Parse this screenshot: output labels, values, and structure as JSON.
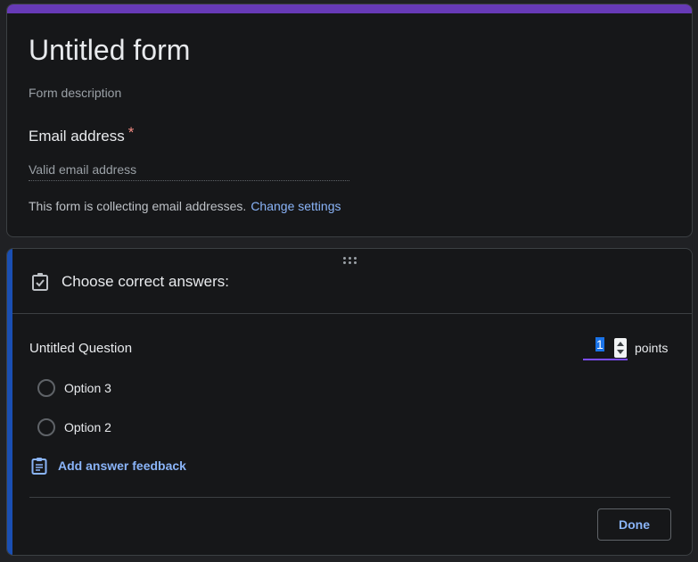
{
  "header": {
    "title": "Untitled form",
    "description": "Form description",
    "email_label": "Email address",
    "required_mark": "*",
    "email_placeholder": "Valid email address",
    "collecting_text": "This form is collecting email addresses.",
    "change_settings_label": "Change settings"
  },
  "question": {
    "section_title": "Choose correct answers:",
    "title": "Untitled Question",
    "points_value": "1",
    "points_label": "points",
    "options": [
      {
        "label": "Option 3"
      },
      {
        "label": "Option 2"
      }
    ],
    "feedback_label": "Add answer feedback",
    "done_label": "Done"
  },
  "icons": {
    "drag": "drag-handle-icon",
    "answer_key": "checkbox-checked-icon",
    "feedback": "clipboard-icon",
    "radio": "radio-unchecked-icon"
  },
  "colors": {
    "theme": "#673ab7",
    "link": "#8ab4f8",
    "required": "#f28b82",
    "focus_bar": "#1a4fb3"
  }
}
